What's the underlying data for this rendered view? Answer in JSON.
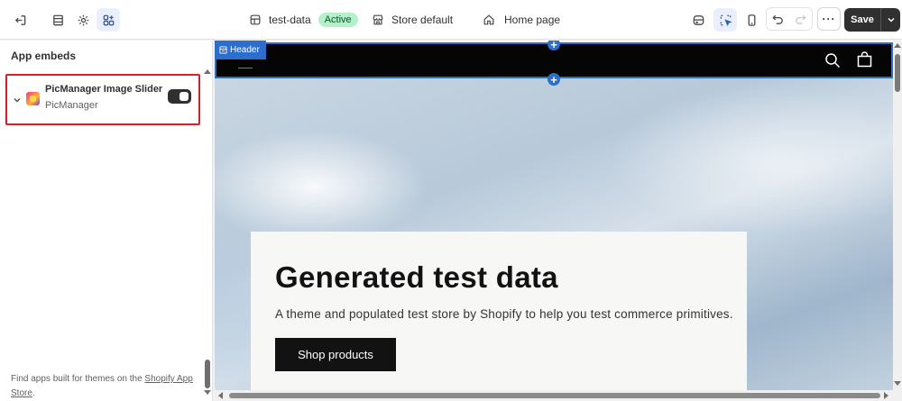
{
  "topbar": {
    "theme_name": "test-data",
    "status_badge": "Active",
    "store_selector": "Store default",
    "page_selector": "Home page",
    "save_label": "Save"
  },
  "sidebar": {
    "title": "App embeds",
    "embed": {
      "name": "PicManager Image Slider",
      "provider": "PicManager",
      "enabled": true
    },
    "footer_text": "Find apps built for themes on the ",
    "footer_link": "Shopify App Store",
    "footer_end": "."
  },
  "preview": {
    "header_tag": "Header",
    "hero": {
      "title": "Generated test data",
      "description": "A theme and populated test store by Shopify to help you test commerce primitives.",
      "button_label": "Shop products"
    }
  },
  "colors": {
    "accent_blue": "#2c6ecb",
    "active_badge_bg": "#b4f0c8",
    "highlight_border": "#d4202b",
    "save_button_bg": "#303030"
  }
}
